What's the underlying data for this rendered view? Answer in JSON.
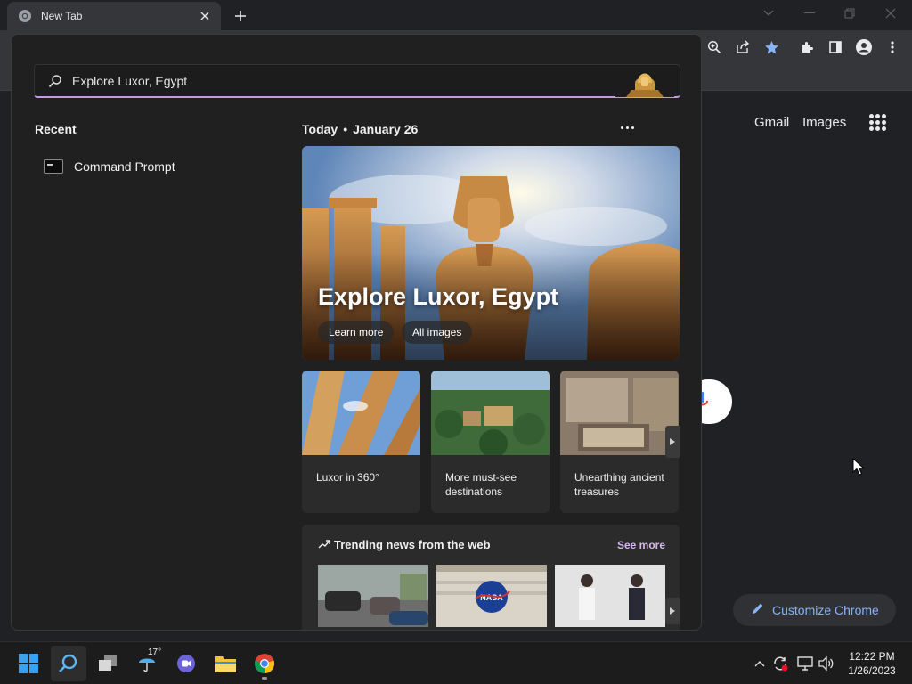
{
  "browser": {
    "tab_title": "New Tab",
    "ntp_links": {
      "gmail": "Gmail",
      "images": "Images"
    },
    "customize_label": "Customize Chrome"
  },
  "search": {
    "query": "Explore Luxor, Egypt",
    "recent_heading": "Recent",
    "recent_items": [
      {
        "label": "Command Prompt",
        "icon": "command-prompt-icon"
      }
    ],
    "today_label": "Today",
    "date_label": "January 26",
    "hero": {
      "title": "Explore Luxor, Egypt",
      "learn_more": "Learn more",
      "all_images": "All images"
    },
    "cards": [
      {
        "label": "Luxor in 360°"
      },
      {
        "label": "More must-see destinations"
      },
      {
        "label": "Unearthing ancient treasures"
      }
    ],
    "trending": {
      "title": "Trending news from the web",
      "see_more": "See more"
    }
  },
  "taskbar": {
    "weather_temp": "17°",
    "time": "12:22 PM",
    "date": "1/26/2023"
  },
  "colors": {
    "accent_blue": "#8ab4f8",
    "search_underline": "#c39be4",
    "see_more": "#d9b8f0",
    "windows_blue": "#3aa0f0"
  }
}
